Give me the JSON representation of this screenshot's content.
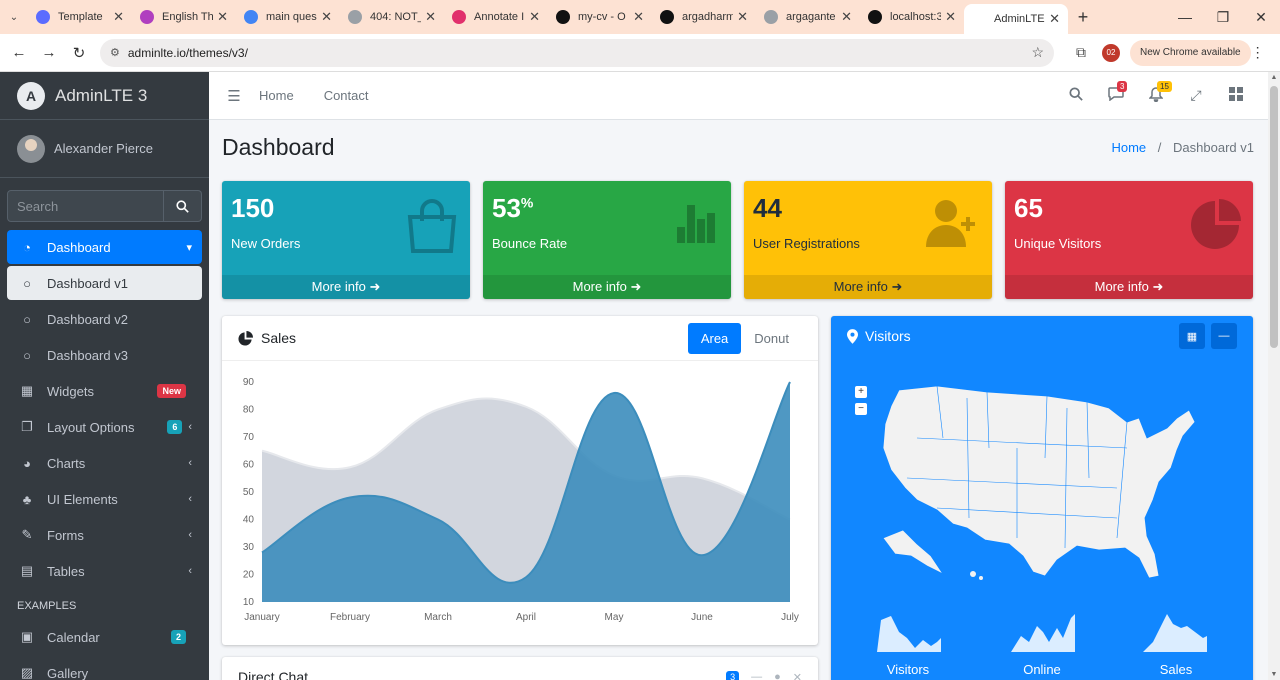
{
  "browser": {
    "tabs": [
      {
        "title": "Template",
        "color": "#5b6cff"
      },
      {
        "title": "English Th",
        "color": "#b03fbf"
      },
      {
        "title": "main ques",
        "color": "#4285f4"
      },
      {
        "title": "404: NOT_",
        "color": "#9aa0a6"
      },
      {
        "title": "Annotate I",
        "color": "#e1306c"
      },
      {
        "title": "my-cv - O",
        "color": "#111111"
      },
      {
        "title": "argadharm",
        "color": "#111111"
      },
      {
        "title": "argagante",
        "color": "#9aa0a6"
      },
      {
        "title": "localhost:3",
        "color": "#111111"
      },
      {
        "title": "AdminLTE",
        "color": "#ffffff"
      }
    ],
    "url": "adminlte.io/themes/v3/",
    "profile_badge": "02",
    "update_label": "New Chrome available"
  },
  "sidebar": {
    "brand": "AdminLTE 3",
    "user": "Alexander Pierce",
    "search_placeholder": "Search",
    "items": [
      {
        "label": "Dashboard",
        "icon": "tachometer-icon"
      },
      {
        "label": "Dashboard v1",
        "icon": "circle-icon"
      },
      {
        "label": "Dashboard v2",
        "icon": "circle-icon"
      },
      {
        "label": "Dashboard v3",
        "icon": "circle-icon"
      },
      {
        "label": "Widgets",
        "icon": "grid-icon",
        "badge": "New"
      },
      {
        "label": "Layout Options",
        "icon": "copy-icon",
        "badge": "6"
      },
      {
        "label": "Charts",
        "icon": "pie-chart-icon"
      },
      {
        "label": "UI Elements",
        "icon": "tree-icon"
      },
      {
        "label": "Forms",
        "icon": "edit-icon"
      },
      {
        "label": "Tables",
        "icon": "table-icon"
      }
    ],
    "examples_header": "EXAMPLES",
    "examples": [
      {
        "label": "Calendar",
        "icon": "calendar-icon",
        "badge": "2"
      },
      {
        "label": "Gallery",
        "icon": "image-icon"
      }
    ]
  },
  "topnav": {
    "home": "Home",
    "contact": "Contact",
    "messages_count": "3",
    "notifications_count": "15"
  },
  "header": {
    "title": "Dashboard",
    "breadcrumb_home": "Home",
    "breadcrumb_sep": "/",
    "breadcrumb_current": "Dashboard v1"
  },
  "small_boxes": [
    {
      "value": "150",
      "sup": "",
      "label": "New Orders",
      "footer": "More info",
      "color": "#17a2b8",
      "icon": "shopping-bag-icon"
    },
    {
      "value": "53",
      "sup": "%",
      "label": "Bounce Rate",
      "footer": "More info",
      "color": "#28a745",
      "icon": "bar-chart-icon"
    },
    {
      "value": "44",
      "sup": "",
      "label": "User Registrations",
      "footer": "More info",
      "color": "#ffc107",
      "icon": "user-plus-icon"
    },
    {
      "value": "65",
      "sup": "",
      "label": "Unique Visitors",
      "footer": "More info",
      "color": "#dc3545",
      "icon": "pie-chart-icon"
    }
  ],
  "sales": {
    "title": "Sales",
    "tab_area": "Area",
    "tab_donut": "Donut"
  },
  "chart_data": {
    "type": "area",
    "categories": [
      "January",
      "February",
      "March",
      "April",
      "May",
      "June",
      "July"
    ],
    "series": [
      {
        "values": [
          65,
          59,
          80,
          81,
          56,
          55,
          40
        ],
        "color": "#d2d6de"
      },
      {
        "values": [
          28,
          48,
          40,
          19,
          86,
          27,
          90
        ],
        "color": "#3c8dbc"
      }
    ],
    "yticks": [
      10,
      20,
      30,
      40,
      50,
      60,
      70,
      80,
      90
    ],
    "ylim": [
      10,
      90
    ],
    "grid": false
  },
  "chat": {
    "title": "Direct Chat",
    "badge": "3"
  },
  "visitors": {
    "title": "Visitors",
    "sparklines": [
      "Visitors",
      "Online",
      "Sales"
    ],
    "zoom_in": "+",
    "zoom_out": "−"
  }
}
